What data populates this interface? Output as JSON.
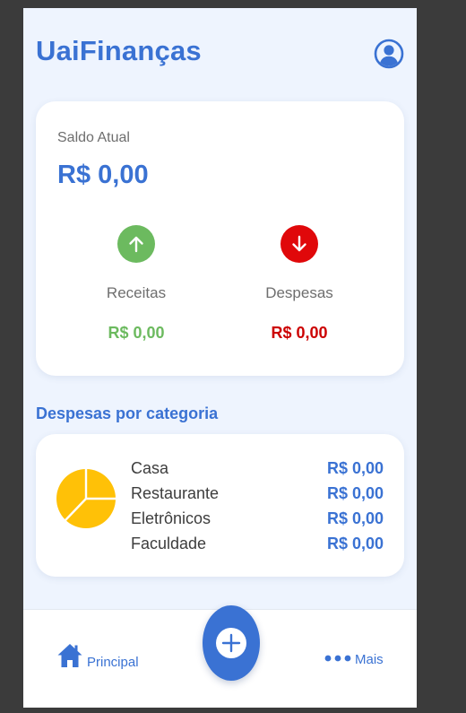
{
  "app": {
    "title": "UaiFinanças"
  },
  "colors": {
    "primary": "#3a72d3",
    "income": "#6cba5f",
    "expense": "#e0080a",
    "pie": "#ffc107",
    "background": "#eef4fe"
  },
  "icons": {
    "profile": "user-circle-icon",
    "income": "arrow-up-icon",
    "expense": "arrow-down-icon",
    "chart": "pie-chart-icon",
    "home": "home-icon",
    "more": "more-dots-icon",
    "add": "plus-icon"
  },
  "balance": {
    "label": "Saldo Atual",
    "value": "R$ 0,00",
    "income_label": "Receitas",
    "income_value": "R$ 0,00",
    "expense_label": "Despesas",
    "expense_value": "R$ 0,00"
  },
  "categories": {
    "title": "Despesas por categoria",
    "items": [
      {
        "name": "Casa",
        "value": "R$ 0,00"
      },
      {
        "name": "Restaurante",
        "value": "R$ 0,00"
      },
      {
        "name": "Eletrônicos",
        "value": "R$ 0,00"
      },
      {
        "name": "Faculdade",
        "value": "R$ 0,00"
      }
    ]
  },
  "nav": {
    "home_label": "Principal",
    "more_label": "Mais"
  }
}
